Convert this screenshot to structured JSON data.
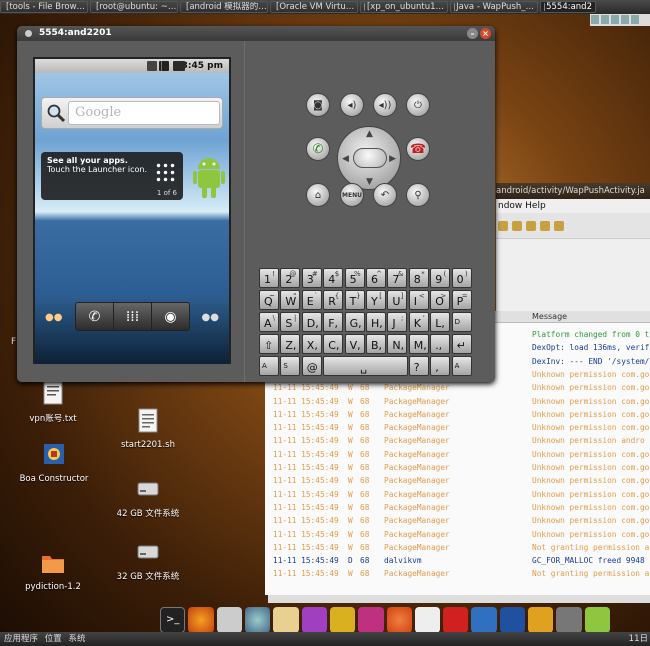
{
  "taskbar": [
    {
      "label": "[tools - File Brow…",
      "active": false
    },
    {
      "label": "[root@ubuntu: ~…",
      "active": false
    },
    {
      "label": "[android 模拟器的…",
      "active": false
    },
    {
      "label": "[Oracle VM Virtu…",
      "active": false
    },
    {
      "label": "[xp_on_ubuntu1…",
      "active": false
    },
    {
      "label": "Java - WapPush_…",
      "active": false
    },
    {
      "label": "5554:and2",
      "active": true
    }
  ],
  "emulator": {
    "title": "5554:and2201",
    "status_time": "3:45 pm",
    "search_placeholder": "Google",
    "tip_title": "See all your apps.",
    "tip_body": "Touch the Launcher icon.",
    "tip_page": "1 of 6",
    "menu_label": "MENU"
  },
  "keyboard": {
    "row1": [
      [
        "1",
        "!"
      ],
      [
        "2",
        "@"
      ],
      [
        "3",
        "#"
      ],
      [
        "4",
        "$"
      ],
      [
        "5",
        "%"
      ],
      [
        "6",
        "^"
      ],
      [
        "7",
        "&"
      ],
      [
        "8",
        "*"
      ],
      [
        "9",
        "("
      ],
      [
        "0",
        ")"
      ]
    ],
    "row2": [
      [
        "Q",
        "~"
      ],
      [
        "W",
        "\""
      ],
      [
        "E",
        "`"
      ],
      [
        "R",
        "{"
      ],
      [
        "T",
        "}"
      ],
      [
        "Y",
        "["
      ],
      [
        "U",
        "]"
      ],
      [
        "I",
        "<"
      ],
      [
        "O",
        ">"
      ],
      [
        "P",
        "="
      ]
    ],
    "row3": [
      [
        "A",
        "\\"
      ],
      [
        "S",
        "|"
      ],
      [
        "D",
        ""
      ],
      [
        "F",
        ""
      ],
      [
        "G",
        ""
      ],
      [
        "H",
        ""
      ],
      [
        "J",
        ";"
      ],
      [
        "K",
        "'"
      ],
      [
        "L",
        ""
      ]
    ],
    "row4": [
      [
        "Z",
        ""
      ],
      [
        "X",
        ""
      ],
      [
        "C",
        ""
      ],
      [
        "V",
        ""
      ],
      [
        "B",
        ""
      ],
      [
        "N",
        ""
      ],
      [
        "M",
        ""
      ],
      [
        ".",
        ""
      ]
    ],
    "del_label": "DEL",
    "alt_label": "ALT",
    "sym_label": "SYM",
    "at_label": "@",
    "slash_label": "/",
    "question_label": "?",
    "comma_label": ","
  },
  "ide": {
    "title": "android/activity/WapPushActivity.ja",
    "menu": "ndow  Help",
    "message_header": "Message",
    "log_rows": [
      {
        "time": "",
        "level": "",
        "pid": "",
        "tag": "",
        "msg": "Platform changed from 0 t",
        "kind": "i"
      },
      {
        "time": "",
        "level": "",
        "pid": "",
        "tag": "",
        "msg": "DexOpt: load 136ms, verif",
        "kind": "d"
      },
      {
        "time": "",
        "level": "",
        "pid": "",
        "tag": "",
        "msg": "DexInv: --- END '/system/",
        "kind": "d"
      },
      {
        "time": "11-11 15:45:49",
        "level": "W",
        "pid": "68",
        "tag": "PackageManager",
        "msg": "Unknown permission com.go",
        "kind": "w"
      },
      {
        "time": "11-11 15:45:49",
        "level": "W",
        "pid": "68",
        "tag": "PackageManager",
        "msg": "Unknown permission com.go",
        "kind": "w"
      },
      {
        "time": "11-11 15:45:49",
        "level": "W",
        "pid": "68",
        "tag": "PackageManager",
        "msg": "Unknown permission com.go",
        "kind": "w"
      },
      {
        "time": "11-11 15:45:49",
        "level": "W",
        "pid": "68",
        "tag": "PackageManager",
        "msg": "Unknown permission com.go",
        "kind": "w"
      },
      {
        "time": "11-11 15:45:49",
        "level": "W",
        "pid": "68",
        "tag": "PackageManager",
        "msg": "Unknown permission com.go",
        "kind": "w"
      },
      {
        "time": "11-11 15:45:49",
        "level": "W",
        "pid": "68",
        "tag": "PackageManager",
        "msg": "Unknown permission andro",
        "kind": "w"
      },
      {
        "time": "11-11 15:45:49",
        "level": "W",
        "pid": "68",
        "tag": "PackageManager",
        "msg": "Unknown permission com.go",
        "kind": "w"
      },
      {
        "time": "11-11 15:45:49",
        "level": "W",
        "pid": "68",
        "tag": "PackageManager",
        "msg": "Unknown permission com.go",
        "kind": "w"
      },
      {
        "time": "11-11 15:45:49",
        "level": "W",
        "pid": "68",
        "tag": "PackageManager",
        "msg": "Unknown permission com.go",
        "kind": "w"
      },
      {
        "time": "11-11 15:45:49",
        "level": "W",
        "pid": "68",
        "tag": "PackageManager",
        "msg": "Unknown permission com.go",
        "kind": "w"
      },
      {
        "time": "11-11 15:45:49",
        "level": "W",
        "pid": "68",
        "tag": "PackageManager",
        "msg": "Unknown permission com.go",
        "kind": "w"
      },
      {
        "time": "11-11 15:45:49",
        "level": "W",
        "pid": "68",
        "tag": "PackageManager",
        "msg": "Unknown permission com.go",
        "kind": "w"
      },
      {
        "time": "11-11 15:45:49",
        "level": "W",
        "pid": "68",
        "tag": "PackageManager",
        "msg": "Unknown permission com.go",
        "kind": "w"
      },
      {
        "time": "11-11 15:45:49",
        "level": "W",
        "pid": "68",
        "tag": "PackageManager",
        "msg": "Not granting permission a",
        "kind": "w"
      },
      {
        "time": "11-11 15:45:49",
        "level": "D",
        "pid": "68",
        "tag": "dalvikvm",
        "msg": "GC_FOR_MALLOC freed 9948",
        "kind": "d"
      },
      {
        "time": "11-11 15:45:49",
        "level": "W",
        "pid": "68",
        "tag": "PackageManager",
        "msg": "Not granting permission a",
        "kind": "w"
      }
    ]
  },
  "desktop_icons": [
    {
      "label": "vpn账号.txt",
      "icon": "text-file-icon"
    },
    {
      "label": "Boa Constructor",
      "icon": "boa-constructor-icon"
    },
    {
      "label": "pydiction-1.2",
      "icon": "folder-icon"
    },
    {
      "label": "start2201.sh",
      "icon": "script-file-icon"
    },
    {
      "label": "42 GB 文件系统",
      "icon": "drive-icon"
    },
    {
      "label": "32 GB 文件系统",
      "icon": "drive-icon"
    }
  ],
  "left_fragment": "F",
  "bottom_panel": {
    "apps": "应用程序",
    "places": "位置",
    "system": "系统",
    "clock": "11日"
  },
  "colors": {
    "log_warn": "#e39c4a",
    "log_debug": "#1b3e8a",
    "log_info": "#2d9a3a"
  }
}
